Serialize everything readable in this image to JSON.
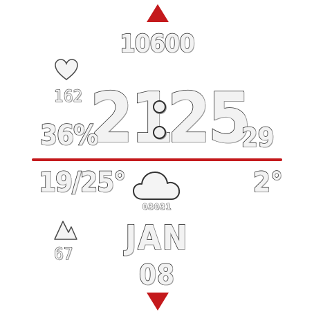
{
  "watchface": {
    "steps": "10600",
    "time": {
      "hours": "21",
      "minutes": "25"
    },
    "heart_rate": "162",
    "battery": "36%",
    "right_value": "29",
    "temp_range": "19/25°",
    "wind_temp": "2°",
    "weather_condition": "03031",
    "elevation": "67",
    "date": {
      "month": "JAN",
      "day": "08"
    },
    "colors": {
      "accent": "#c4191c",
      "outline": "#2e2e2e",
      "fill": "#f2f2f2"
    },
    "icons": [
      "heart-icon",
      "cloud-icon",
      "mountain-icon",
      "up-arrow-icon",
      "down-arrow-icon"
    ]
  }
}
